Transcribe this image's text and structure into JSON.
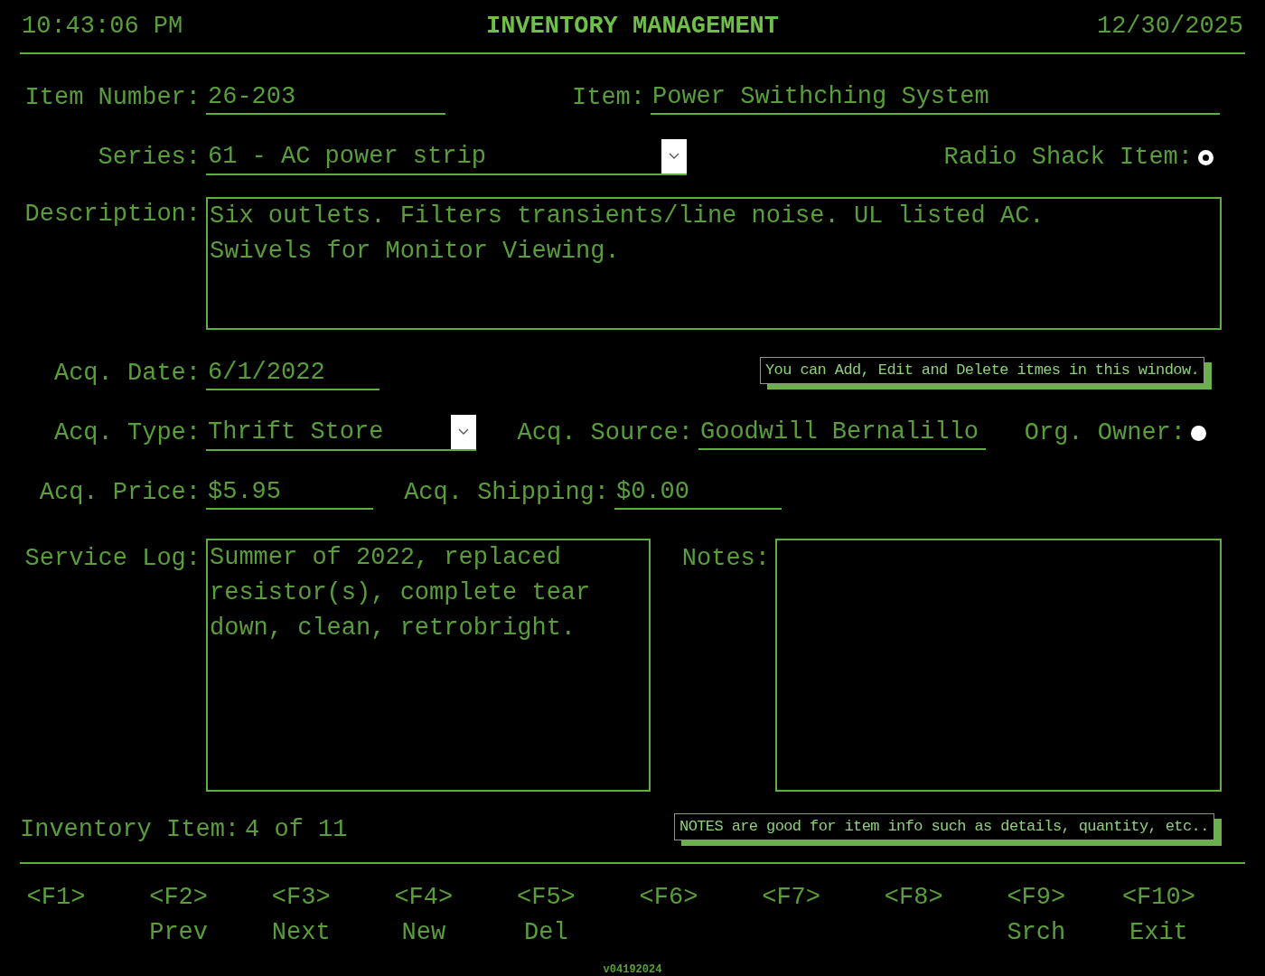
{
  "header": {
    "time": "10:43:06 PM",
    "title": "INVENTORY MANAGEMENT",
    "date": "12/30/2025"
  },
  "item_number": {
    "label": "Item Number:",
    "value": "26-203"
  },
  "item": {
    "label": "Item:",
    "value": "Power Swithching System"
  },
  "series": {
    "label": "Series:",
    "value": "61 - AC power strip"
  },
  "radio_shack_item": {
    "label": "Radio Shack Item:",
    "checked": true
  },
  "description": {
    "label": "Description:",
    "value": "Six outlets. Filters transients/line noise. UL listed AC.\nSwivels for Monitor Viewing."
  },
  "acq_date": {
    "label": "Acq. Date:",
    "value": "6/1/2022"
  },
  "hint_top": "You can Add, Edit and Delete itmes in this window.",
  "acq_type": {
    "label": "Acq. Type:",
    "value": "Thrift Store"
  },
  "acq_source": {
    "label": "Acq. Source:",
    "value": "Goodwill Bernalillo"
  },
  "org_owner": {
    "label": "Org. Owner:",
    "checked": false
  },
  "acq_price": {
    "label": "Acq. Price:",
    "value": "$5.95"
  },
  "acq_shipping": {
    "label": "Acq. Shipping:",
    "value": "$0.00"
  },
  "service_log": {
    "label": "Service Log:",
    "value": "Summer of 2022, replaced resistor(s), complete tear down, clean, retrobright."
  },
  "notes": {
    "label": "Notes:"
  },
  "record": {
    "label": "Inventory Item:",
    "value": "4 of 11"
  },
  "hint_bottom": "NOTES are good for item info such as details, quantity, etc..",
  "function_keys": [
    {
      "key": "<F1>"
    },
    {
      "key": "<F2>",
      "action": "Prev"
    },
    {
      "key": "<F3>",
      "action": "Next"
    },
    {
      "key": "<F4>",
      "action": "New"
    },
    {
      "key": "<F5>",
      "action": "Del"
    },
    {
      "key": "<F6>"
    },
    {
      "key": "<F7>"
    },
    {
      "key": "<F8>"
    },
    {
      "key": "<F9>",
      "action": "Srch"
    },
    {
      "key": "<F10>",
      "action": "Exit"
    }
  ],
  "version": "v04192024"
}
